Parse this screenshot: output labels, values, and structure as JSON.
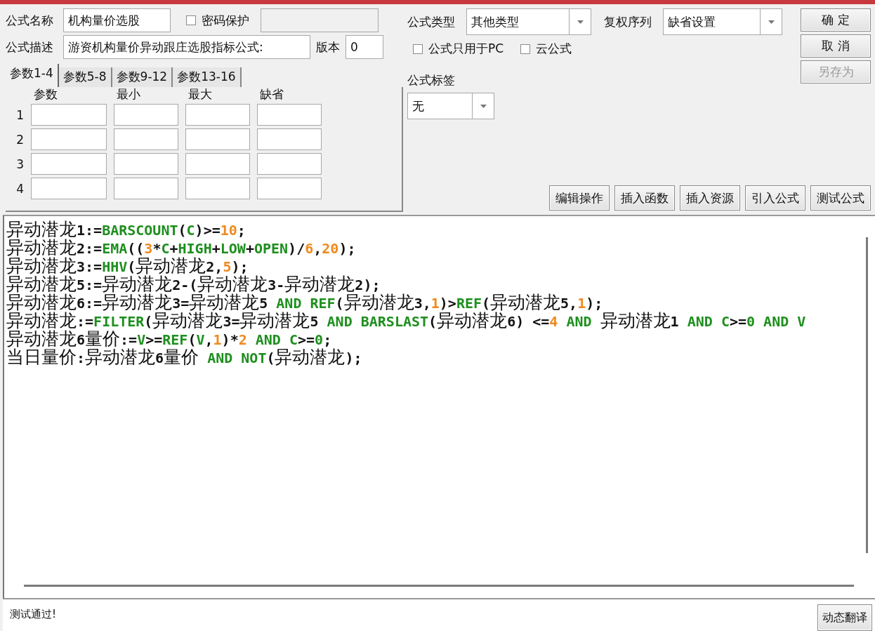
{
  "formula_name": {
    "label": "公式名称",
    "value": "机构量价选股"
  },
  "password": {
    "label": "密码保护",
    "checked": false
  },
  "description": {
    "label": "公式描述",
    "value": "游资机构量价异动跟庄选股指标公式:"
  },
  "version": {
    "label": "版本",
    "value": "0"
  },
  "param_tabs": [
    {
      "label": "参数1-4",
      "selected": true
    },
    {
      "label": "参数5-8",
      "selected": false
    },
    {
      "label": "参数9-12",
      "selected": false
    },
    {
      "label": "参数13-16",
      "selected": false
    }
  ],
  "param_table": {
    "columns": [
      "参数",
      "最小",
      "最大",
      "缺省"
    ],
    "rows": [
      "1",
      "2",
      "3",
      "4"
    ]
  },
  "formula_type": {
    "label": "公式类型",
    "value": "其他类型"
  },
  "adjust": {
    "label": "复权序列",
    "value": "缺省设置"
  },
  "options": [
    {
      "label": "公式只用于PC",
      "checked": false
    },
    {
      "label": "云公式",
      "checked": false
    }
  ],
  "tag": {
    "label": "公式标签",
    "value": "无"
  },
  "dialog_buttons": [
    {
      "label": "确 定",
      "disabled": false
    },
    {
      "label": "取 消",
      "disabled": false
    },
    {
      "label": "另存为",
      "disabled": true
    }
  ],
  "action_buttons": [
    "编辑操作",
    "插入函数",
    "插入资源",
    "引入公式",
    "测试公式"
  ],
  "code_lines": [
    [
      {
        "kind": "cn",
        "text": "异动潜龙"
      },
      {
        "kind": "sym",
        "text": "1:="
      },
      {
        "kind": "fn",
        "text": "BARSCOUNT"
      },
      {
        "kind": "sym",
        "text": "("
      },
      {
        "kind": "fn",
        "text": "C"
      },
      {
        "kind": "sym",
        "text": ")>="
      },
      {
        "kind": "num",
        "text": "10"
      },
      {
        "kind": "sym",
        "text": ";"
      }
    ],
    [
      {
        "kind": "cn",
        "text": "异动潜龙"
      },
      {
        "kind": "sym",
        "text": "2:="
      },
      {
        "kind": "fn",
        "text": "EMA"
      },
      {
        "kind": "sym",
        "text": "(("
      },
      {
        "kind": "num",
        "text": "3"
      },
      {
        "kind": "sym",
        "text": "*"
      },
      {
        "kind": "fn",
        "text": "C"
      },
      {
        "kind": "sym",
        "text": "+"
      },
      {
        "kind": "fn",
        "text": "HIGH"
      },
      {
        "kind": "sym",
        "text": "+"
      },
      {
        "kind": "fn",
        "text": "LOW"
      },
      {
        "kind": "sym",
        "text": "+"
      },
      {
        "kind": "fn",
        "text": "OPEN"
      },
      {
        "kind": "sym",
        "text": ")/"
      },
      {
        "kind": "num",
        "text": "6"
      },
      {
        "kind": "sym",
        "text": ","
      },
      {
        "kind": "num",
        "text": "20"
      },
      {
        "kind": "sym",
        "text": ");"
      }
    ],
    [
      {
        "kind": "cn",
        "text": "异动潜龙"
      },
      {
        "kind": "sym",
        "text": "3:="
      },
      {
        "kind": "fn",
        "text": "HHV"
      },
      {
        "kind": "sym",
        "text": "("
      },
      {
        "kind": "cn",
        "text": "异动潜龙"
      },
      {
        "kind": "sym",
        "text": "2,"
      },
      {
        "kind": "num",
        "text": "5"
      },
      {
        "kind": "sym",
        "text": ");"
      }
    ],
    [
      {
        "kind": "cn",
        "text": "异动潜龙"
      },
      {
        "kind": "sym",
        "text": "5:="
      },
      {
        "kind": "cn",
        "text": "异动潜龙"
      },
      {
        "kind": "sym",
        "text": "2-("
      },
      {
        "kind": "cn",
        "text": "异动潜龙"
      },
      {
        "kind": "sym",
        "text": "3-"
      },
      {
        "kind": "cn",
        "text": "异动潜龙"
      },
      {
        "kind": "sym",
        "text": "2);"
      }
    ],
    [
      {
        "kind": "cn",
        "text": "异动潜龙"
      },
      {
        "kind": "sym",
        "text": "6:="
      },
      {
        "kind": "cn",
        "text": "异动潜龙"
      },
      {
        "kind": "sym",
        "text": "3="
      },
      {
        "kind": "cn",
        "text": "异动潜龙"
      },
      {
        "kind": "sym",
        "text": "5"
      },
      {
        "kind": "fn",
        "text": " AND "
      },
      {
        "kind": "fn",
        "text": "REF"
      },
      {
        "kind": "sym",
        "text": "("
      },
      {
        "kind": "cn",
        "text": "异动潜龙"
      },
      {
        "kind": "sym",
        "text": "3,"
      },
      {
        "kind": "num",
        "text": "1"
      },
      {
        "kind": "sym",
        "text": ")>"
      },
      {
        "kind": "fn",
        "text": "REF"
      },
      {
        "kind": "sym",
        "text": "("
      },
      {
        "kind": "cn",
        "text": "异动潜龙"
      },
      {
        "kind": "sym",
        "text": "5,"
      },
      {
        "kind": "num",
        "text": "1"
      },
      {
        "kind": "sym",
        "text": ");"
      }
    ],
    [
      {
        "kind": "cn",
        "text": "异动潜龙"
      },
      {
        "kind": "sym",
        "text": ":="
      },
      {
        "kind": "fn",
        "text": "FILTER"
      },
      {
        "kind": "sym",
        "text": "("
      },
      {
        "kind": "cn",
        "text": "异动潜龙"
      },
      {
        "kind": "sym",
        "text": "3="
      },
      {
        "kind": "cn",
        "text": "异动潜龙"
      },
      {
        "kind": "sym",
        "text": "5"
      },
      {
        "kind": "fn",
        "text": " AND "
      },
      {
        "kind": "fn",
        "text": "BARSLAST"
      },
      {
        "kind": "sym",
        "text": "("
      },
      {
        "kind": "cn",
        "text": "异动潜龙"
      },
      {
        "kind": "sym",
        "text": "6) <="
      },
      {
        "kind": "num",
        "text": "4"
      },
      {
        "kind": "fn",
        "text": " AND "
      },
      {
        "kind": "cn",
        "text": "异动潜龙"
      },
      {
        "kind": "sym",
        "text": "1"
      },
      {
        "kind": "fn",
        "text": " AND "
      },
      {
        "kind": "fn",
        "text": "C"
      },
      {
        "kind": "sym",
        "text": ">="
      },
      {
        "kind": "fn",
        "text": "0"
      },
      {
        "kind": "fn",
        "text": " AND "
      },
      {
        "kind": "fn",
        "text": "V"
      }
    ],
    [
      {
        "kind": "cn",
        "text": "异动潜龙"
      },
      {
        "kind": "sym",
        "text": "6"
      },
      {
        "kind": "cn",
        "text": "量价"
      },
      {
        "kind": "sym",
        "text": ":="
      },
      {
        "kind": "fn",
        "text": "V"
      },
      {
        "kind": "sym",
        "text": ">="
      },
      {
        "kind": "fn",
        "text": "REF"
      },
      {
        "kind": "sym",
        "text": "("
      },
      {
        "kind": "fn",
        "text": "V"
      },
      {
        "kind": "sym",
        "text": ","
      },
      {
        "kind": "num",
        "text": "1"
      },
      {
        "kind": "sym",
        "text": ")*"
      },
      {
        "kind": "num",
        "text": "2"
      },
      {
        "kind": "fn",
        "text": " AND "
      },
      {
        "kind": "fn",
        "text": "C"
      },
      {
        "kind": "sym",
        "text": ">="
      },
      {
        "kind": "fn",
        "text": "0"
      },
      {
        "kind": "sym",
        "text": ";"
      }
    ],
    [
      {
        "kind": "cn",
        "text": "当日量价"
      },
      {
        "kind": "sym",
        "text": ":"
      },
      {
        "kind": "cn",
        "text": "异动潜龙"
      },
      {
        "kind": "sym",
        "text": "6"
      },
      {
        "kind": "cn",
        "text": "量价"
      },
      {
        "kind": "fn",
        "text": " AND "
      },
      {
        "kind": "fn",
        "text": "NOT"
      },
      {
        "kind": "sym",
        "text": "("
      },
      {
        "kind": "cn",
        "text": "异动潜龙"
      },
      {
        "kind": "sym",
        "text": ");"
      }
    ]
  ],
  "status": {
    "message": "测试通过!"
  },
  "translate_button": {
    "label": "动态翻译"
  }
}
